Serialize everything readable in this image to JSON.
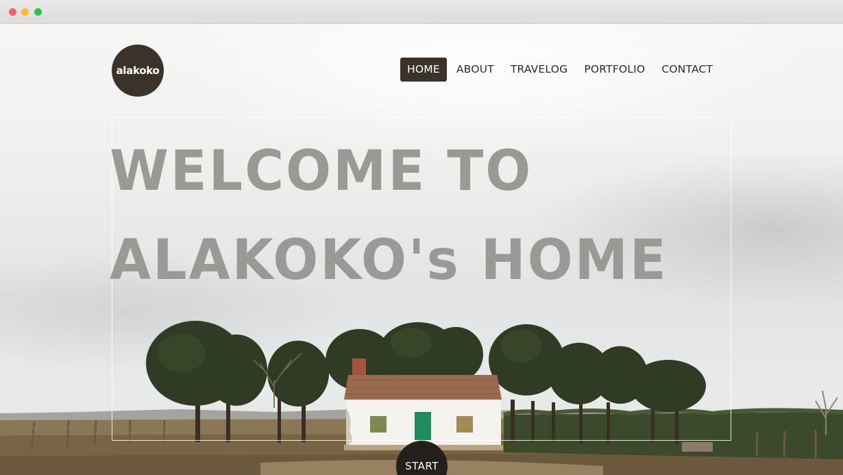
{
  "browser": {
    "window_controls": [
      "close",
      "minimize",
      "maximize"
    ]
  },
  "brand": {
    "logo_text": "alakoko"
  },
  "nav": {
    "items": [
      {
        "label": "HOME",
        "active": true
      },
      {
        "label": "ABOUT",
        "active": false
      },
      {
        "label": "TRAVELOG",
        "active": false
      },
      {
        "label": "PORTFOLIO",
        "active": false
      },
      {
        "label": "CONTACT",
        "active": false
      }
    ]
  },
  "hero": {
    "heading_line1": "WELCOME TO",
    "heading_line2": "ALAKOKO's HOME",
    "background": "countryside white house with trees under cloudy sky"
  },
  "cta": {
    "start_label": "START"
  },
  "colors": {
    "brand_dark": "#3b332a",
    "heading_gray": "#9a9995",
    "start_button": "#231f1b"
  }
}
